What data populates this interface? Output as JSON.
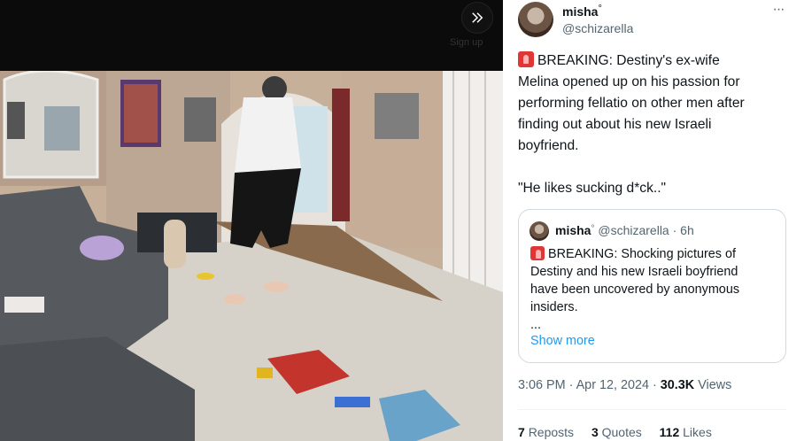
{
  "media": {
    "topbar_ghost_text": [
      "Sign up"
    ]
  },
  "tweet": {
    "author": {
      "name": "misha",
      "badge": "°",
      "handle": "@schizarella"
    },
    "more_label": "···",
    "text_lines": [
      "BREAKING: Destiny's ex-wife",
      "Melina opened up on his passion for",
      "performing fellatio on other men after",
      "finding out about his new Israeli",
      "boyfriend.",
      "",
      "\"He likes sucking d*ck..\""
    ],
    "quote": {
      "name": "misha",
      "badge": "°",
      "handle": "@schizarella",
      "time": "· 6h",
      "text": "BREAKING: Shocking pictures of\nDestiny and his new Israeli boyfriend\nhave been uncovered by anonymous\ninsiders.\n...",
      "show_more": "Show more"
    },
    "meta": {
      "time": "3:06 PM · Apr 12, 2024 ·",
      "views_count": "30.3K",
      "views_label": "Views"
    },
    "stats": [
      {
        "count": "7",
        "label": "Reposts"
      },
      {
        "count": "3",
        "label": "Quotes"
      },
      {
        "count": "112",
        "label": "Likes"
      }
    ]
  }
}
